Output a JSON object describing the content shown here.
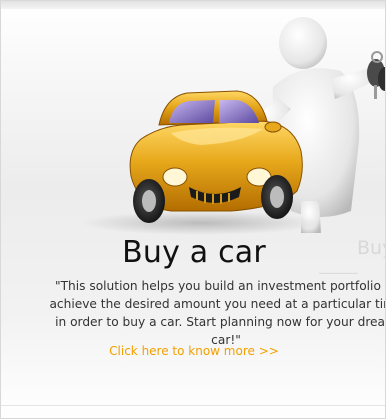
{
  "card": {
    "title": "Buy a car",
    "description": "\"This solution helps you build an investment portfolio to achieve the desired amount you need at a particular time in order to buy a car. Start planning now for your dream car!\"",
    "cta_label": "Click here to know more >>"
  },
  "background_card": {
    "title": "Buy"
  },
  "colors": {
    "car_body": "#e7a81b",
    "cta": "#f2a000",
    "title": "#111111",
    "text": "#333333"
  },
  "icons": [
    "car-illustration",
    "3d-person-figure",
    "car-keys-icon"
  ]
}
